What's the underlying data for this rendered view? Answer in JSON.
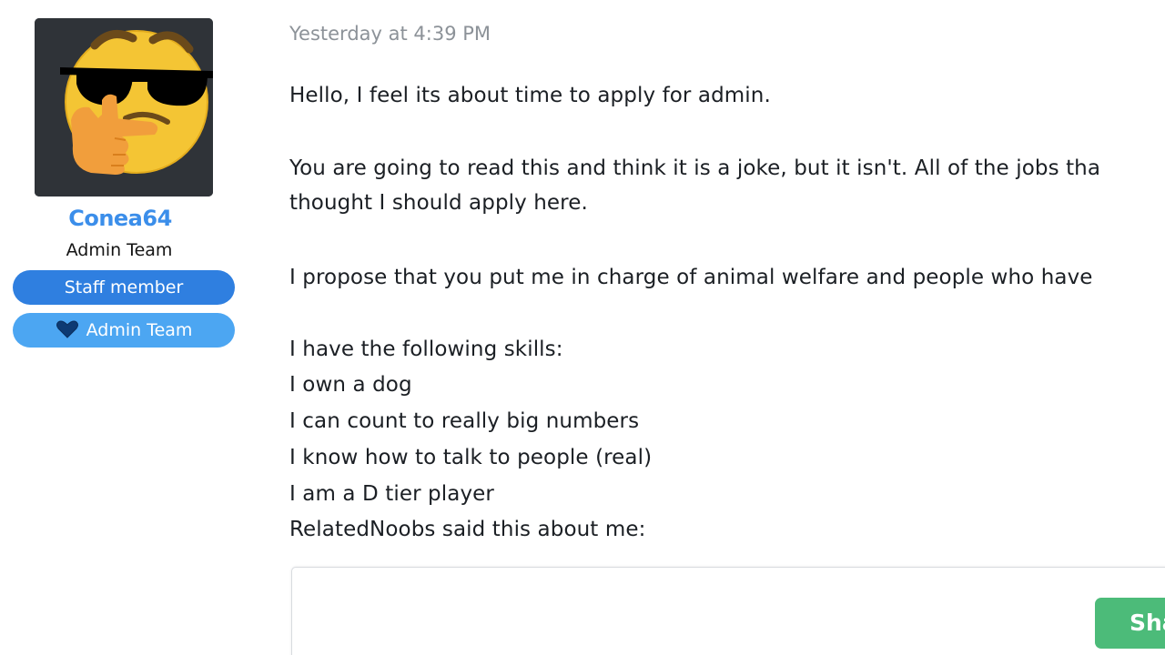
{
  "user": {
    "name": "Conea64",
    "title": "Admin Team",
    "banners": [
      {
        "label": "Staff member",
        "color": "#2f7fe0"
      },
      {
        "label": "Admin Team",
        "color": "#4ca6f2",
        "icon": "heart-icon"
      }
    ],
    "name_color": "#3b8eea"
  },
  "post": {
    "timestamp": "Yesterday at 4:39 PM",
    "lines": [
      "Hello, I feel its about time to apply for admin.",
      "You are going to read this and think it is a joke, but it isn't. All of the jobs tha",
      "thought I should apply here.",
      "I propose that you put me in charge of animal welfare and people who have",
      "I have the following skills:",
      "I own a dog",
      "I can count to really big numbers",
      "I know how to talk to people (real)",
      "I am a D tier player",
      "RelatedNoobs said this about me:"
    ],
    "embed": {
      "button_label": "Sha",
      "button_color": "#4cbb79"
    }
  }
}
